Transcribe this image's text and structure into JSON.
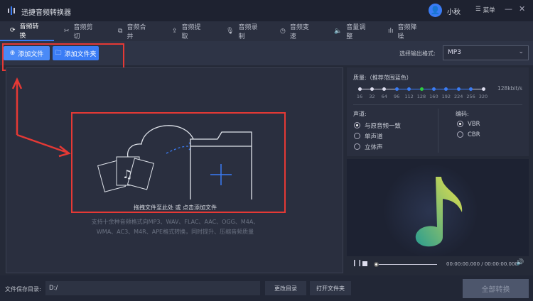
{
  "app": {
    "title": "迅捷音频转换器",
    "user": "小秋",
    "menu": "菜单"
  },
  "tabs": [
    {
      "label": "音频转换",
      "icon": "refresh-icon"
    },
    {
      "label": "音频剪切",
      "icon": "scissors-icon"
    },
    {
      "label": "音频合并",
      "icon": "merge-icon"
    },
    {
      "label": "音频提取",
      "icon": "extract-icon"
    },
    {
      "label": "音频录制",
      "icon": "microphone-icon"
    },
    {
      "label": "音频变速",
      "icon": "speed-icon"
    },
    {
      "label": "音量调整",
      "icon": "volume-icon"
    },
    {
      "label": "音频降噪",
      "icon": "denoise-icon"
    }
  ],
  "toolbar": {
    "add_file": "添加文件",
    "add_folder": "添加文件夹",
    "format_label": "选择输出格式:",
    "format_value": "MP3"
  },
  "dropzone": {
    "hint": "拖拽文件至此处 或 点击添加文件",
    "desc1": "支持十余种音频格式向MP3、WAV、FLAC、AAC、OGG、M4A、",
    "desc2": "WMA、AC3、M4R、APE格式转换，同时提升、压缩音频质量"
  },
  "quality": {
    "label": "质量:（推荐范围蓝色）",
    "ticks": [
      "16",
      "32",
      "64",
      "96",
      "112",
      "128",
      "160",
      "192",
      "224",
      "256",
      "320"
    ],
    "selected": "128",
    "recommended_range": [
      "96",
      "256"
    ],
    "value_text": "128kbit/s"
  },
  "channel": {
    "label": "声道:",
    "options": [
      "与原音频一致",
      "单声道",
      "立体声"
    ],
    "selected": 0
  },
  "encoding": {
    "label": "编码:",
    "options": [
      "VBR",
      "CBR"
    ],
    "selected": 0
  },
  "player": {
    "time": "00:00:00.000 / 00:00:00.000",
    "progress": 0
  },
  "bottom": {
    "save_label": "文件保存目录:",
    "save_path": "D:/",
    "change_dir": "更改目录",
    "open_folder": "打开文件夹",
    "convert_all": "全部转换"
  },
  "colors": {
    "accent": "#3a7cf5",
    "selected_tick": "#2ecc40",
    "annotation": "#e53935"
  }
}
